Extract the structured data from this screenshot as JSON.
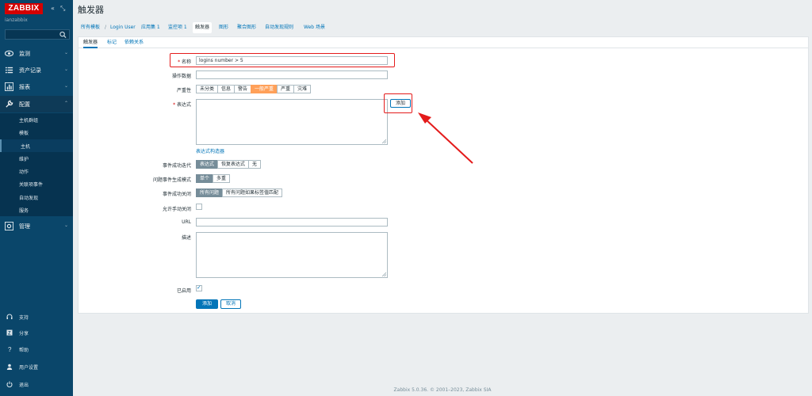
{
  "app": {
    "logo": "ZABBIX",
    "server_name": "ianzabbix",
    "page_title": "触发器"
  },
  "sidebar": {
    "sections": [
      {
        "label": "监测",
        "icon": "eye-icon"
      },
      {
        "label": "资产记录",
        "icon": "list-icon"
      },
      {
        "label": "报表",
        "icon": "bar-chart-icon"
      },
      {
        "label": "配置",
        "icon": "wrench-icon"
      },
      {
        "label": "管理",
        "icon": "gear-icon"
      }
    ],
    "config_items": [
      "主机群组",
      "模板",
      "主机",
      "维护",
      "动作",
      "关联项事件",
      "自动发现",
      "服务"
    ],
    "bottom_items": [
      {
        "label": "支持",
        "icon": "headset-icon"
      },
      {
        "label": "分享",
        "icon": "share-icon"
      },
      {
        "label": "帮助",
        "icon": "help-icon"
      },
      {
        "label": "用户设置",
        "icon": "user-icon"
      },
      {
        "label": "退出",
        "icon": "power-icon"
      }
    ]
  },
  "breadcrumbs": {
    "all_hosts": "所有模板",
    "sep": "/",
    "host": "Login User",
    "tabs": [
      "应用集 1",
      "监控项 1",
      "触发器",
      "图形",
      "聚合图形",
      "自动发现规则",
      "Web 场景"
    ]
  },
  "form_tabs": [
    "触发器",
    "标记",
    "依赖关系"
  ],
  "form": {
    "name_label": "名称",
    "name_value": "logins number > 5",
    "opdata_label": "操作数据",
    "severity_label": "严重性",
    "severity_options": [
      "未分类",
      "信息",
      "警告",
      "一般严重",
      "严重",
      "灾难"
    ],
    "severity_selected": "一般严重",
    "expression_label": "表达式",
    "add_button": "添加",
    "expression_constructor": "表达式构造器",
    "ok_event_label": "事件成功迭代",
    "ok_event_options": [
      "表达式",
      "恢复表达式",
      "无"
    ],
    "problem_mode_label": "问题事件生成模式",
    "problem_mode_options": [
      "单个",
      "多重"
    ],
    "ok_close_label": "事件成功关闭",
    "ok_close_options": [
      "所有问题",
      "所有问题如果标签值匹配"
    ],
    "manual_close_label": "允许手动关闭",
    "url_label": "URL",
    "desc_label": "描述",
    "enabled_label": "已启用",
    "submit_button": "添加",
    "cancel_button": "取消"
  },
  "footer": "Zabbix 5.0.36. © 2001–2023, Zabbix SIA",
  "colors": {
    "sidebar": "#0a466a",
    "logo": "#d40000",
    "accent": "#0275b8",
    "severity_average": "#ffa059",
    "highlight": "#e41b1b"
  }
}
